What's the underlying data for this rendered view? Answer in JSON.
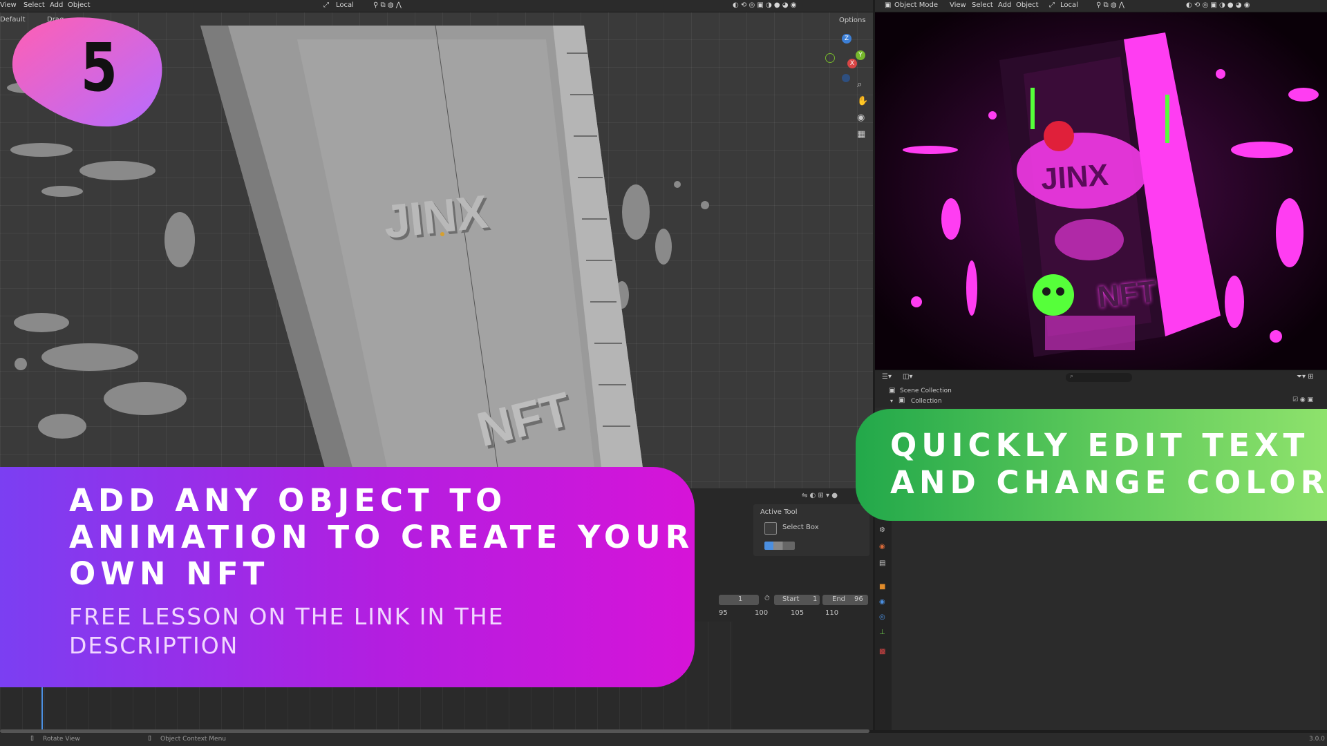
{
  "colors": {
    "purple_start": "#7b3ff2",
    "purple_end": "#d614d8",
    "green_start": "#22a84a",
    "green_end": "#8ee26c",
    "blob_start": "#ff5fb3",
    "blob_end": "#b66cff",
    "neon_pink": "#ff3df2",
    "neon_green": "#56ff3a",
    "gizmo_x": "#d84545",
    "gizmo_y": "#76b82c",
    "gizmo_z": "#3c7fd6"
  },
  "left_header": {
    "menus": [
      "View",
      "Select",
      "Add",
      "Object"
    ],
    "orientation": "Local",
    "transform_orientation": "Default",
    "drag_label": "Drag",
    "options": "Options"
  },
  "right_header": {
    "mode": "Object Mode",
    "menus": [
      "View",
      "Select",
      "Add",
      "Object"
    ],
    "orientation": "Local"
  },
  "viewport_left": {
    "model_word_1": "JINX",
    "model_word_2": "NFT",
    "gizmo_labels": [
      "Z",
      "Y",
      "X"
    ]
  },
  "viewport_right": {
    "model_word_1": "JINX",
    "model_word_2": "NFT"
  },
  "outliner": {
    "scene_collection": "Scene Collection",
    "collection": "Collection"
  },
  "tool_panel": {
    "title": "Active Tool",
    "tool": "Select Box"
  },
  "timeline": {
    "current_frame": "1",
    "start_label": "Start",
    "start_value": "1",
    "end_label": "End",
    "end_value": "96",
    "ticks": [
      "95",
      "100",
      "105",
      "110"
    ]
  },
  "status_bar": {
    "hint_1": "Rotate View",
    "hint_2": "Object Context Menu",
    "version": "3.0.0"
  },
  "badge": {
    "number": "5"
  },
  "banner_left": {
    "title_line_1": "ADD ANY OBJECT TO",
    "title_line_2": "ANIMATION TO CREATE YOUR",
    "title_line_3": "OWN NFT",
    "subtitle_line_1": "FREE LESSON ON THE LINK IN THE",
    "subtitle_line_2": "DESCRIPTION"
  },
  "banner_right": {
    "line_1": "QUICKLY EDIT TEXT",
    "line_2": "AND CHANGE COLOR"
  }
}
